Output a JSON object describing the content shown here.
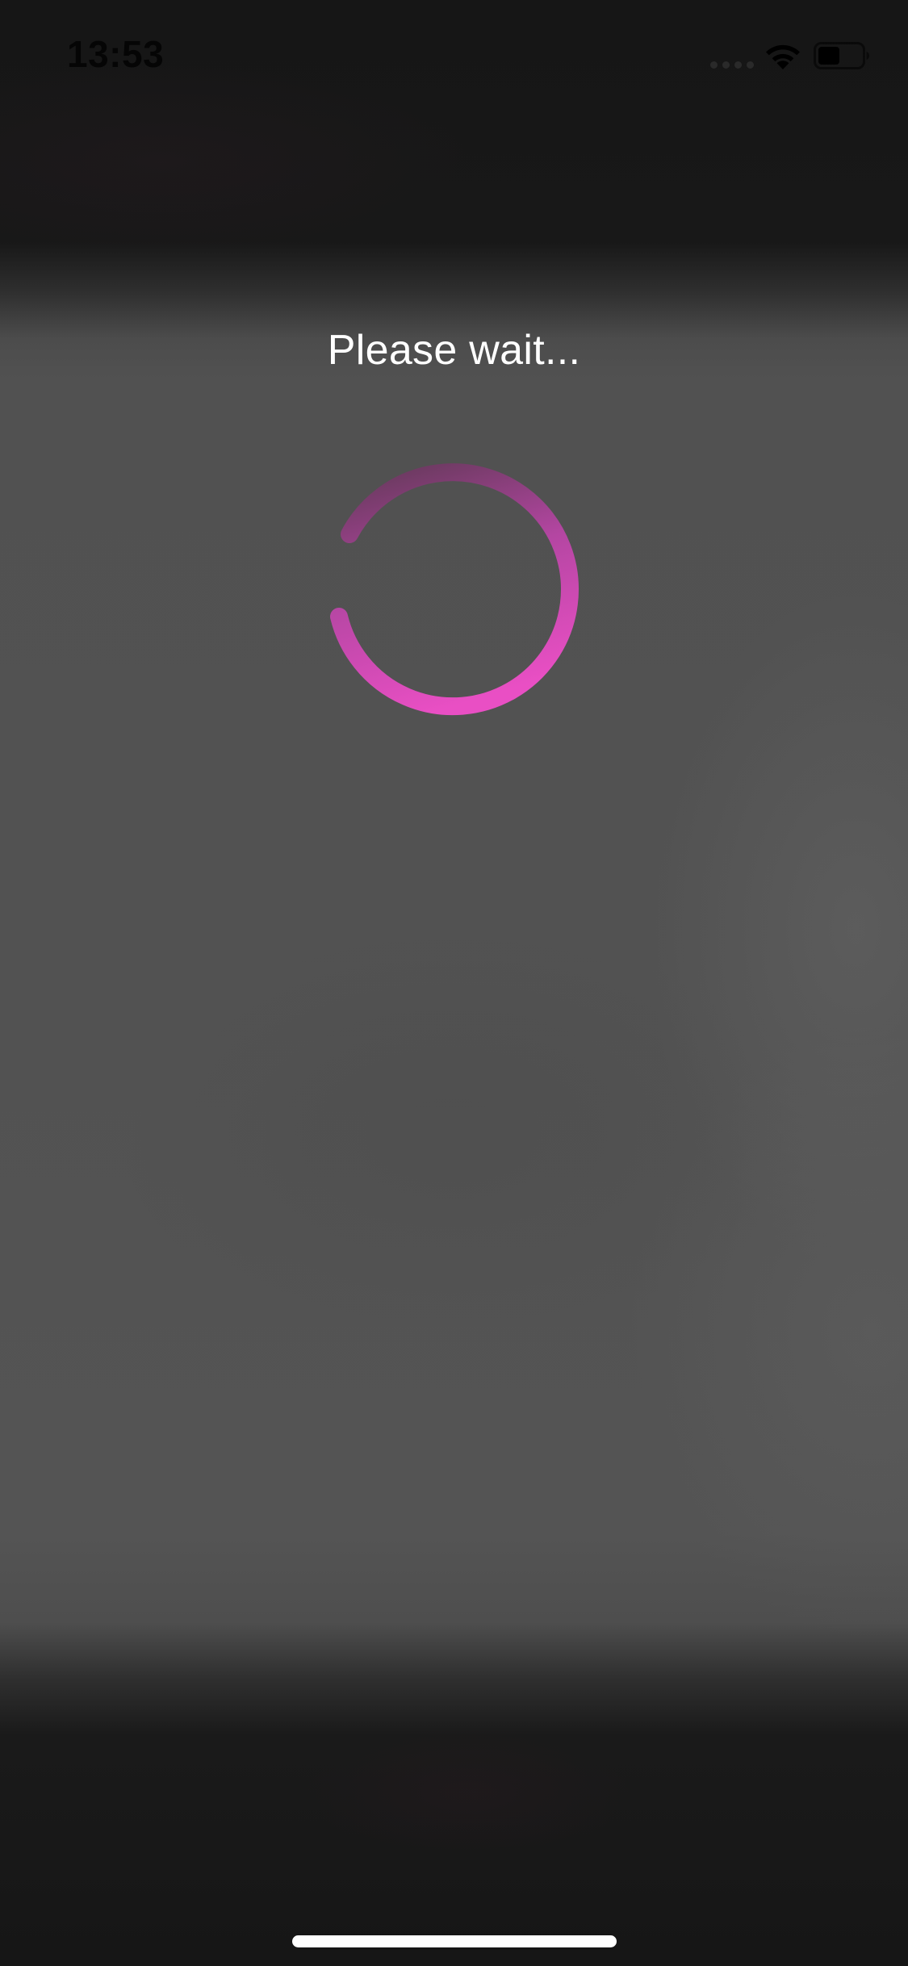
{
  "status_bar": {
    "time": "13:53",
    "battery_level": 0.5,
    "icons": [
      "signal-icon",
      "wifi-icon",
      "battery-icon"
    ]
  },
  "loading_overlay": {
    "message": "Please wait...",
    "spinner_icon": "loading-spinner-icon",
    "spinner_colors": {
      "head": "#e94fc4",
      "tail": "#6b3a60"
    }
  },
  "colors": {
    "background": "#161616",
    "dimmed_content": "#525252",
    "text": "#ffffff",
    "accent": "#e94fc4"
  }
}
